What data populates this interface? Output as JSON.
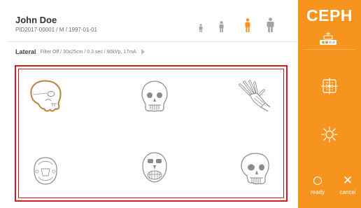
{
  "patient": {
    "name": "John Doe",
    "info": "PID2017-00001 / M / 1997-01-01"
  },
  "patient_sizes": {
    "selected_index": 2,
    "icons": [
      "child-icon",
      "youth-icon",
      "adult-icon",
      "large-adult-icon"
    ]
  },
  "mode": {
    "name": "Lateral",
    "params": "Filter Off / 30x25cm / 0.3 sec / 90kVp, 17mA"
  },
  "regions": {
    "selected": "lateral-skull",
    "items": [
      "lateral-skull",
      "frontal-skull",
      "hand",
      "submentovertex",
      "waters-view",
      "oblique-skull"
    ]
  },
  "panel": {
    "title": "CEPH",
    "ready_label": "ready",
    "cancel_label": "cancel"
  },
  "colors": {
    "accent": "#f7941d",
    "selection_border": "#d71920",
    "icon_gray": "#9a9a9a",
    "sensor_green": "#8dc63f"
  }
}
